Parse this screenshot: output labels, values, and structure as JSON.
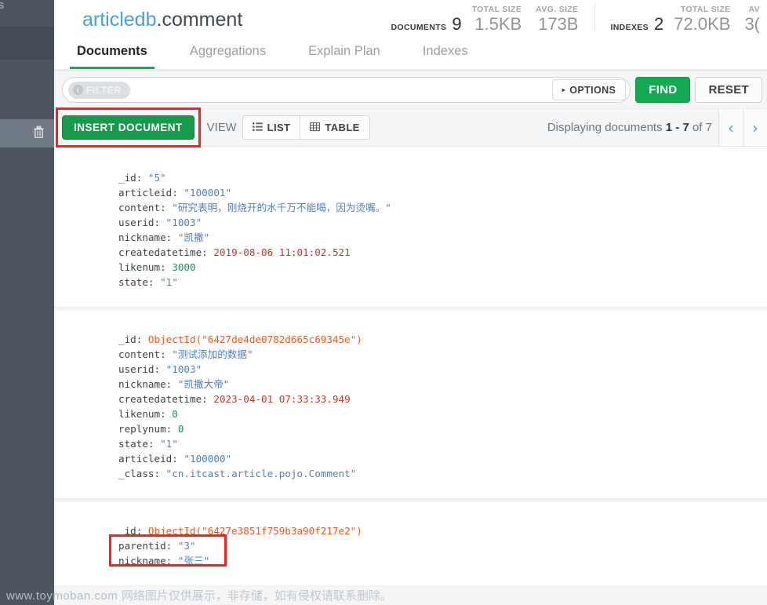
{
  "sidebar": {
    "top_fragment": "s",
    "trash_icon": "trash-icon"
  },
  "header": {
    "database": "articledb",
    "separator": ".",
    "collection": "comment",
    "stats": {
      "documents_label": "DOCUMENTS",
      "documents_count": "9",
      "doc_total_size_label": "TOTAL SIZE",
      "doc_total_size_value": "1.5KB",
      "doc_avg_size_label": "AVG. SIZE",
      "doc_avg_size_value": "173B",
      "indexes_label": "INDEXES",
      "indexes_count": "2",
      "idx_total_size_label": "TOTAL SIZE",
      "idx_total_size_value": "72.0KB",
      "idx_avg_size_label": "AV",
      "idx_avg_size_value": "3("
    }
  },
  "tabs": [
    {
      "label": "Documents",
      "active": true
    },
    {
      "label": "Aggregations",
      "active": false
    },
    {
      "label": "Explain Plan",
      "active": false
    },
    {
      "label": "Indexes",
      "active": false
    }
  ],
  "filter_bar": {
    "badge_label": "FILTER",
    "info_glyph": "i",
    "input_value": "",
    "input_placeholder": "",
    "options_label": "OPTIONS",
    "options_caret": "▸",
    "find_label": "FIND",
    "reset_label": "RESET"
  },
  "toolbar": {
    "insert_label": "INSERT DOCUMENT",
    "view_label": "VIEW",
    "list_label": "LIST",
    "list_icon": "list-icon",
    "table_label": "TABLE",
    "table_icon": "table-icon",
    "paging_prefix": "Displaying documents",
    "paging_from": "1",
    "paging_dash": "-",
    "paging_to": "7",
    "paging_of": "of",
    "paging_total": "7",
    "prev_glyph": "‹",
    "next_glyph": "›"
  },
  "documents": [
    {
      "fields": [
        {
          "key": "_id",
          "value": "\"5\"",
          "type": "string"
        },
        {
          "key": "articleid",
          "value": "\"100001\"",
          "type": "string"
        },
        {
          "key": "content",
          "value": "\"研究表明，刚烧开的水千万不能喝，因为烫嘴。\"",
          "type": "string"
        },
        {
          "key": "userid",
          "value": "\"1003\"",
          "type": "string"
        },
        {
          "key": "nickname",
          "value": "\"凯撒\"",
          "type": "string"
        },
        {
          "key": "createdatetime",
          "value": "2019-08-06 11:01:02.521",
          "type": "date"
        },
        {
          "key": "likenum",
          "value": "3000",
          "type": "number"
        },
        {
          "key": "state",
          "value": "\"1\"",
          "type": "string"
        }
      ]
    },
    {
      "fields": [
        {
          "key": "_id",
          "value": "ObjectId(\"6427de4de0782d665c69345e\")",
          "type": "oid"
        },
        {
          "key": "content",
          "value": "\"测试添加的数据\"",
          "type": "string"
        },
        {
          "key": "userid",
          "value": "\"1003\"",
          "type": "string"
        },
        {
          "key": "nickname",
          "value": "\"凯撒大帝\"",
          "type": "string"
        },
        {
          "key": "createdatetime",
          "value": "2023-04-01 07:33:33.949",
          "type": "date"
        },
        {
          "key": "likenum",
          "value": "0",
          "type": "number"
        },
        {
          "key": "replynum",
          "value": "0",
          "type": "number"
        },
        {
          "key": "state",
          "value": "\"1\"",
          "type": "string"
        },
        {
          "key": "articleid",
          "value": "\"100000\"",
          "type": "string"
        },
        {
          "key": "_class",
          "value": "\"cn.itcast.article.pojo.Comment\"",
          "type": "string"
        }
      ]
    },
    {
      "fields": [
        {
          "key": "_id",
          "value": "ObjectId(\"6427e3851f759b3a90f217e2\")",
          "type": "oid"
        },
        {
          "key": "parentid",
          "value": "\"3\"",
          "type": "string"
        },
        {
          "key": "nickname",
          "value": "\"张三\"",
          "type": "string"
        }
      ]
    }
  ],
  "watermark": {
    "site": "www.toymoban.com",
    "notice": "网络图片仅供展示，非存储，如有侵权请联系删除。"
  },
  "colors": {
    "accent_green": "#13aa52",
    "db_blue": "#43a2d8",
    "highlight_red": "#f5211f",
    "sidebar_bg": "#4d5560",
    "string_blue": "#4f80bd",
    "number_green": "#2e8b57",
    "date_red": "#c0392b",
    "objectid_orange": "#f0581f"
  }
}
